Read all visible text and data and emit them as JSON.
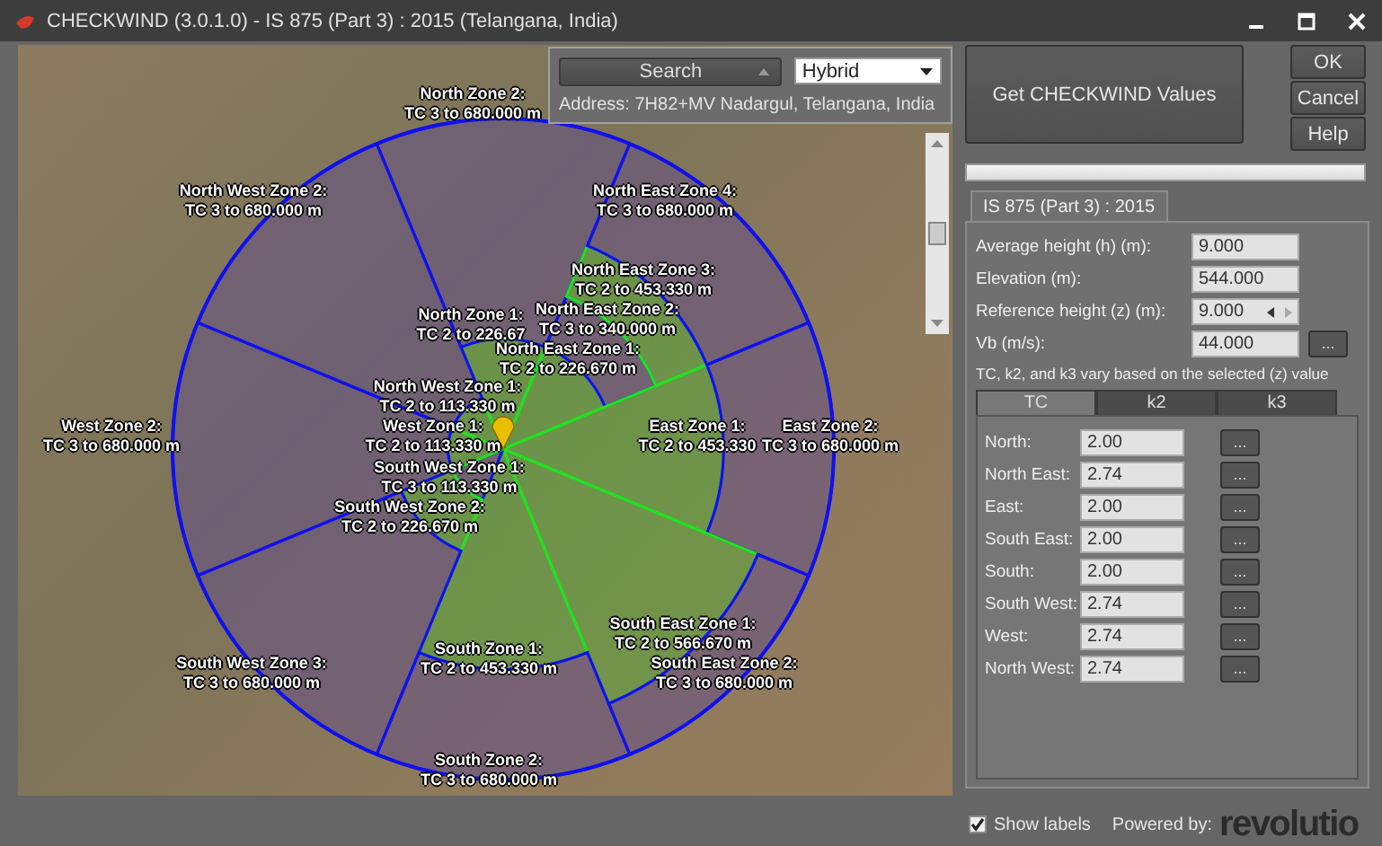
{
  "window": {
    "title": "CHECKWIND (3.0.1.0) - IS 875 (Part 3) : 2015 (Telangana, India)"
  },
  "map": {
    "search_button": "Search",
    "map_type": "Hybrid",
    "address": "Address: 7H82+MV Nadargul, Telangana, India",
    "zone_labels": [
      {
        "name": "North Zone 2:",
        "range": "TC 3 to 680.000 m"
      },
      {
        "name": "North West Zone 2:",
        "range": "TC 3 to 680.000 m"
      },
      {
        "name": "North East Zone 4:",
        "range": "TC 3 to 680.000 m"
      },
      {
        "name": "North East Zone 3:",
        "range": "TC 2 to 453.330 m"
      },
      {
        "name": "North Zone 1:",
        "range": "TC 2 to 226.67"
      },
      {
        "name": "North East Zone 2:",
        "range": "TC 3 to 340.000 m"
      },
      {
        "name": "North East Zone 1:",
        "range": "TC 2 to 226.670 m"
      },
      {
        "name": "North West Zone 1:",
        "range": "TC 2 to 113.330 m"
      },
      {
        "name": "West Zone 2:",
        "range": "TC 3 to 680.000 m"
      },
      {
        "name": "West Zone 1:",
        "range": "TC 2 to 113.330 m"
      },
      {
        "name": "East Zone 1:",
        "range": "TC 2 to 453.330"
      },
      {
        "name": "East Zone 2:",
        "range": "TC 3 to 680.000 m"
      },
      {
        "name": "South West Zone 1:",
        "range": "TC 3 to 113.330 m"
      },
      {
        "name": "South West Zone 2:",
        "range": "TC 2 to 226.670 m"
      },
      {
        "name": "South East Zone 1:",
        "range": "TC 2 to 566.670 m"
      },
      {
        "name": "South Zone 1:",
        "range": "TC 2 to 453.330 m"
      },
      {
        "name": "South West Zone 3:",
        "range": "TC 3 to 680.000 m"
      },
      {
        "name": "South East Zone 2:",
        "range": "TC 3 to 680.000 m"
      },
      {
        "name": "South Zone 2:",
        "range": "TC 3 to 680.000 m"
      }
    ]
  },
  "progress": {
    "level": 0
  },
  "actions": {
    "get_values": "Get CHECKWIND Values",
    "buttons": [
      "OK",
      "Cancel",
      "Help"
    ]
  },
  "standard_tab": {
    "label": "IS 875 (Part 3) : 2015",
    "selected": true
  },
  "fields": [
    {
      "label": "Average height (h) (m):",
      "value": "9.000",
      "kind": "plain"
    },
    {
      "label": "Elevation (m):",
      "value": "544.000",
      "kind": "plain"
    },
    {
      "label": "Reference height (z) (m):",
      "value": "9.000",
      "kind": "spin"
    },
    {
      "label": "Vb (m/s):",
      "value": "44.000",
      "kind": "browse",
      "button": "..."
    }
  ],
  "note": "TC, k2, and k3 vary based on the selected (z) value",
  "factor_tabs": [
    {
      "label": "TC",
      "selected": true
    },
    {
      "label": "k2",
      "selected": false
    },
    {
      "label": "k3",
      "selected": false
    }
  ],
  "directions": [
    {
      "label": "North:",
      "value": "2.00",
      "button": "..."
    },
    {
      "label": "North East:",
      "value": "2.74",
      "button": "..."
    },
    {
      "label": "East:",
      "value": "2.00",
      "button": "..."
    },
    {
      "label": "South East:",
      "value": "2.00",
      "button": "..."
    },
    {
      "label": "South:",
      "value": "2.00",
      "button": "..."
    },
    {
      "label": "South West:",
      "value": "2.74",
      "button": "..."
    },
    {
      "label": "West:",
      "value": "2.74",
      "button": "..."
    },
    {
      "label": "North West:",
      "value": "2.74",
      "button": "..."
    }
  ],
  "show_labels": {
    "label": "Show labels",
    "checked": true
  },
  "powered_by": {
    "label": "Powered by:",
    "logo": "revolutio"
  }
}
